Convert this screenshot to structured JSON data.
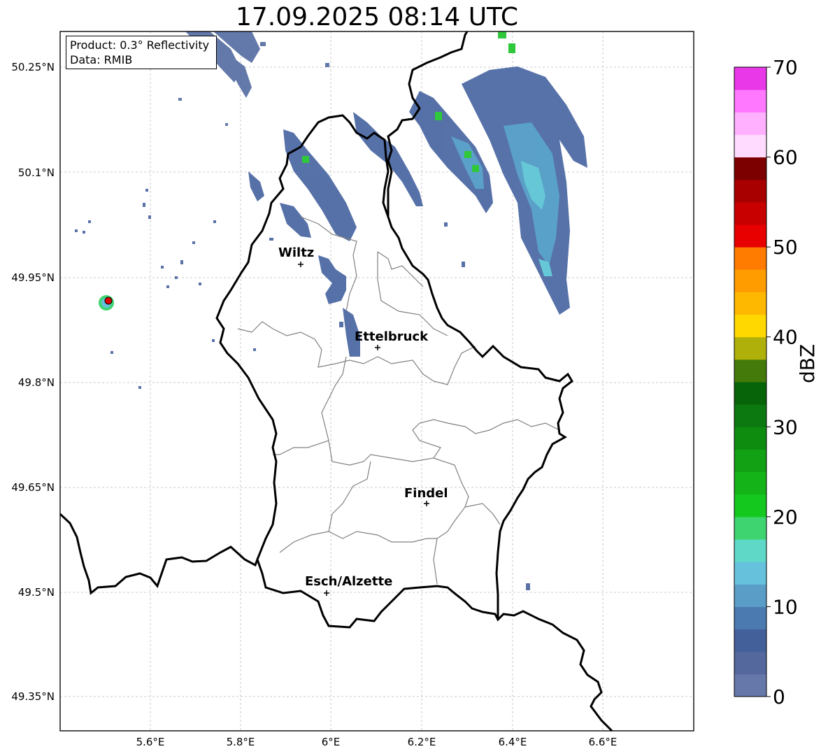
{
  "title": "17.09.2025 08:14 UTC",
  "info": {
    "product": "Product: 0.3° Reflectivity",
    "data": "Data: RMIB"
  },
  "lat_ticks": [
    "50.25°N",
    "50.1°N",
    "49.95°N",
    "49.8°N",
    "49.65°N",
    "49.5°N",
    "49.35°N"
  ],
  "lon_ticks": [
    "5.6°E",
    "5.8°E",
    "6°E",
    "6.2°E",
    "6.4°E",
    "6.6°E"
  ],
  "cities": [
    {
      "name": "Wiltz"
    },
    {
      "name": "Ettelbruck"
    },
    {
      "name": "Findel"
    },
    {
      "name": "Esch/Alzette"
    }
  ],
  "colorbar": {
    "label": "dBZ",
    "ticks": [
      "0",
      "10",
      "20",
      "30",
      "40",
      "50",
      "60",
      "70"
    ],
    "colors": [
      "#6677aa",
      "#54689e",
      "#44609a",
      "#4a7ab0",
      "#5a9ec8",
      "#66c2dc",
      "#60d8c8",
      "#3ed470",
      "#14c81e",
      "#14b418",
      "#12a014",
      "#0e8c10",
      "#0c7810",
      "#086408",
      "#447a0a",
      "#b0b00a",
      "#ffd800",
      "#ffb800",
      "#ff9c00",
      "#ff7c00",
      "#e80000",
      "#c80000",
      "#a80000",
      "#7c0000",
      "#ffdcff",
      "#ffb0ff",
      "#ff78ff",
      "#e838e8"
    ]
  }
}
